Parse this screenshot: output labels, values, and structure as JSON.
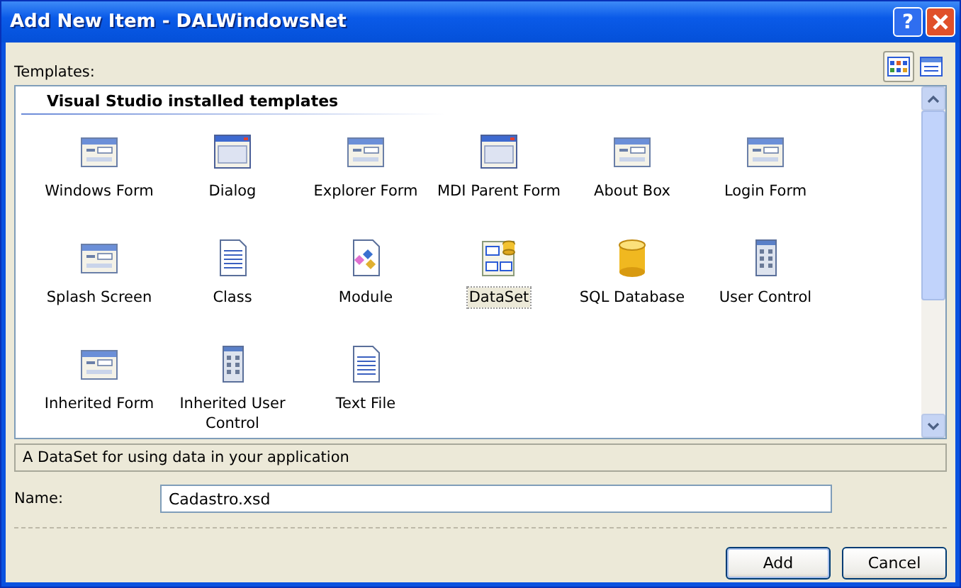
{
  "window": {
    "title": "Add New Item - DALWindowsNet",
    "help_button": "?"
  },
  "templates_label": "Templates:",
  "view_buttons": [
    {
      "kind": "large-icons",
      "selected": true
    },
    {
      "kind": "small-icons",
      "selected": false
    }
  ],
  "group_header": "Visual Studio installed templates",
  "items": [
    {
      "label": "Windows Form",
      "kind": "form",
      "selected": false
    },
    {
      "label": "Dialog",
      "kind": "dialog",
      "selected": false
    },
    {
      "label": "Explorer Form",
      "kind": "form",
      "selected": false
    },
    {
      "label": "MDI Parent Form",
      "kind": "dialog",
      "selected": false
    },
    {
      "label": "About Box",
      "kind": "form",
      "selected": false
    },
    {
      "label": "Login Form",
      "kind": "form",
      "selected": false
    },
    {
      "label": "Splash Screen",
      "kind": "form",
      "selected": false
    },
    {
      "label": "Class",
      "kind": "document",
      "selected": false
    },
    {
      "label": "Module",
      "kind": "module",
      "selected": false
    },
    {
      "label": "DataSet",
      "kind": "dataset",
      "selected": true
    },
    {
      "label": "SQL Database",
      "kind": "database",
      "selected": false
    },
    {
      "label": "User Control",
      "kind": "grid",
      "selected": false
    },
    {
      "label": "Inherited Form",
      "kind": "form",
      "selected": false
    },
    {
      "label": "Inherited User Control",
      "kind": "grid",
      "selected": false
    },
    {
      "label": "Text File",
      "kind": "document",
      "selected": false
    }
  ],
  "description": "A DataSet for using data in your application",
  "name_label": "Name:",
  "name_value": "Cadastro.xsd",
  "buttons": [
    "Add",
    "Cancel"
  ]
}
